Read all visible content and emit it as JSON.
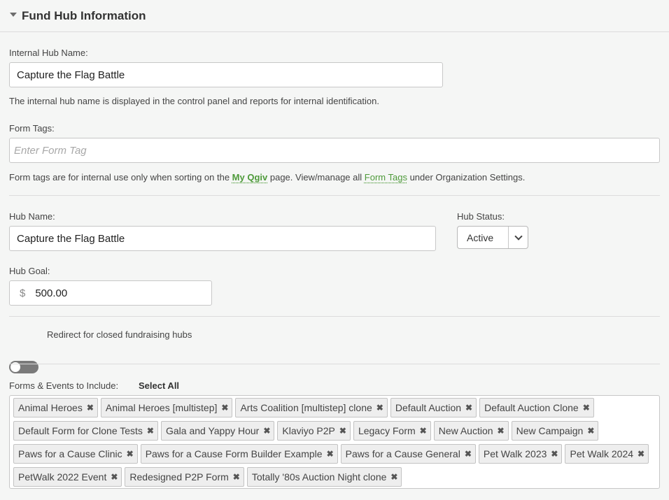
{
  "header": {
    "title": "Fund Hub Information",
    "caret_icon": "caret-down-icon"
  },
  "internal_hub": {
    "label": "Internal Hub Name:",
    "value": "Capture the Flag Battle",
    "help": "The internal hub name is displayed in the control panel and reports for internal identification."
  },
  "form_tags": {
    "label": "Form Tags:",
    "placeholder": "Enter Form Tag",
    "help_prefix": "Form tags are for internal use only when sorting on the ",
    "link_myqgiv": "My Qgiv",
    "help_middle": " page. View/manage all ",
    "link_form_tags": "Form Tags",
    "help_suffix": " under Organization Settings."
  },
  "hub_name": {
    "label": "Hub Name:",
    "value": "Capture the Flag Battle"
  },
  "hub_status": {
    "label": "Hub Status:",
    "value": "Active",
    "icon": "chevron-down-icon"
  },
  "hub_goal": {
    "label": "Hub Goal:",
    "currency": "$",
    "value": "500.00"
  },
  "redirect": {
    "label": "Redirect for closed fundraising hubs",
    "enabled": false
  },
  "forms_events": {
    "label": "Forms & Events to Include:",
    "select_all": "Select All",
    "tags": [
      "Animal Heroes",
      "Animal Heroes [multistep]",
      "Arts Coalition [multistep] clone",
      "Default Auction",
      "Default Auction Clone",
      "Default Form for Clone Tests",
      "Gala and Yappy Hour",
      "Klaviyo P2P",
      "Legacy Form",
      "New Auction",
      "New Campaign",
      "Paws for a Cause Clinic",
      "Paws for a Cause Form Builder Example",
      "Paws for a Cause General",
      "Pet Walk 2023",
      "Pet Walk 2024",
      "PetWalk 2022 Event",
      "Redesigned P2P Form",
      "Totally '80s Auction Night clone"
    ],
    "remove_symbol": "✖"
  }
}
